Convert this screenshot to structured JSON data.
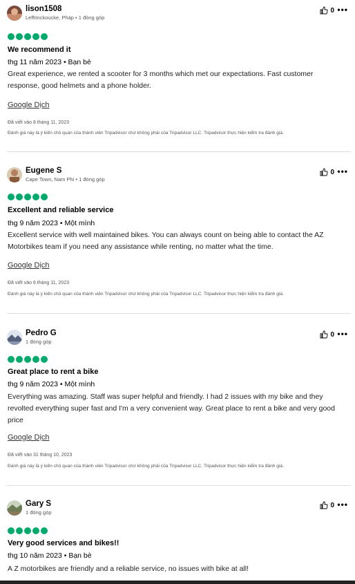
{
  "reviews": [
    {
      "user": "lison1508",
      "meta": "Leffrinckoucke, Pháp • 1 đóng góp",
      "likes": "0",
      "title": "We recommend it",
      "date": "thg 11 năm 2023 • Bạn bè",
      "body": "Great experience, we rented a scooter for 3 months which met our expectations. Fast customer response, good helmets and a phone holder.",
      "translate": "Google Dịch",
      "written": "Đã viết vào 8 tháng 11, 2023",
      "disclaimer": "Đánh giá này là ý kiến chủ quan của thành viên Tripadvisor chứ không phải của Tripadvisor LLC. Tripadvisor thực hiện kiểm tra đánh giá."
    },
    {
      "user": "Eugene S",
      "meta": "Cape Town, Nam Phi • 1 đóng góp",
      "likes": "0",
      "title": "Excellent and reliable service",
      "date": "thg 9 năm 2023 • Một mình",
      "body": "Excellent service with well maintained bikes. You can always count on being able to contact the AZ Motorbikes team if you need any assistance while renting, no matter what the time.",
      "translate": "Google Dịch",
      "written": "Đã viết vào 6 tháng 11, 2023",
      "disclaimer": "Đánh giá này là ý kiến chủ quan của thành viên Tripadvisor chứ không phải của Tripadvisor LLC. Tripadvisor thực hiện kiểm tra đánh giá."
    },
    {
      "user": "Pedro G",
      "meta": "1 đóng góp",
      "likes": "0",
      "title": "Great place to rent a bike",
      "date": "thg 9 năm 2023 • Một mình",
      "body": "Everything was amazing. Staff was super helpful and friendly. I had 2 issues with my bike and they revolted everything super fast and I'm a very convenient way. Great place to rent a bike and very good price",
      "translate": "Google Dịch",
      "written": "Đã viết vào 31 tháng 10, 2023",
      "disclaimer": "Đánh giá này là ý kiến chủ quan của thành viên Tripadvisor chứ không phải của Tripadvisor LLC. Tripadvisor thực hiện kiểm tra đánh giá."
    },
    {
      "user": "Gary S",
      "meta": "1 đóng góp",
      "likes": "0",
      "title": "Very good services and bikes!!",
      "date": "thg 10 năm 2023 • Bạn bè",
      "body": "A Z motorbikes are friendly and a reliable service, no issues with bike at all!"
    }
  ],
  "rating": {
    "value": 5,
    "max": 5,
    "color": "#00aa6c"
  },
  "icons": {
    "like": "thumbs-up-icon",
    "more": "more-options-icon"
  }
}
